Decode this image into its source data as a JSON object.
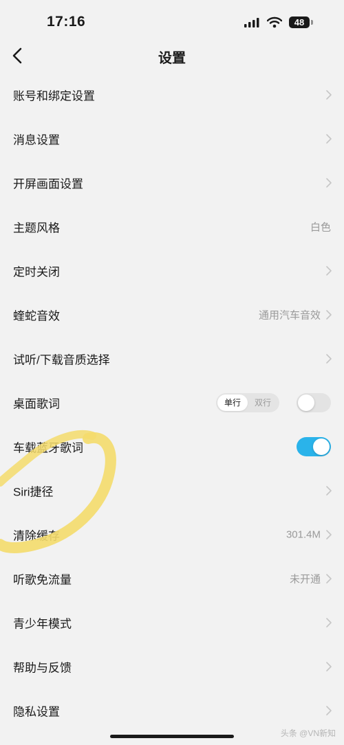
{
  "status_bar": {
    "time": "17:16",
    "battery": "48"
  },
  "nav": {
    "title": "设置"
  },
  "settings": [
    {
      "label": "账号和绑定设置",
      "value": "",
      "control": "chevron"
    },
    {
      "label": "消息设置",
      "value": "",
      "control": "chevron"
    },
    {
      "label": "开屏画面设置",
      "value": "",
      "control": "chevron"
    },
    {
      "label": "主题风格",
      "value": "白色",
      "control": "value"
    },
    {
      "label": "定时关闭",
      "value": "",
      "control": "chevron"
    },
    {
      "label": "蝰蛇音效",
      "value": "通用汽车音效",
      "control": "chevron"
    },
    {
      "label": "试听/下载音质选择",
      "value": "",
      "control": "chevron"
    },
    {
      "label": "桌面歌词",
      "control": "segmented-toggle",
      "segments": [
        "单行",
        "双行"
      ],
      "selected_segment": "单行",
      "toggle_on": false
    },
    {
      "label": "车载蓝牙歌词",
      "control": "toggle",
      "toggle_on": true
    },
    {
      "label": "Siri捷径",
      "value": "",
      "control": "chevron"
    },
    {
      "label": "清除缓存",
      "value": "301.4M",
      "control": "chevron"
    },
    {
      "label": "听歌免流量",
      "value": "未开通",
      "control": "chevron"
    },
    {
      "label": "青少年模式",
      "value": "",
      "control": "chevron"
    },
    {
      "label": "帮助与反馈",
      "value": "",
      "control": "chevron"
    },
    {
      "label": "隐私设置",
      "value": "",
      "control": "chevron"
    }
  ],
  "watermark": "头条 @VN新知",
  "colors": {
    "background": "#f2f2f2",
    "toggle_on": "#2ab3ea",
    "highlight": "#f4dc6c"
  }
}
